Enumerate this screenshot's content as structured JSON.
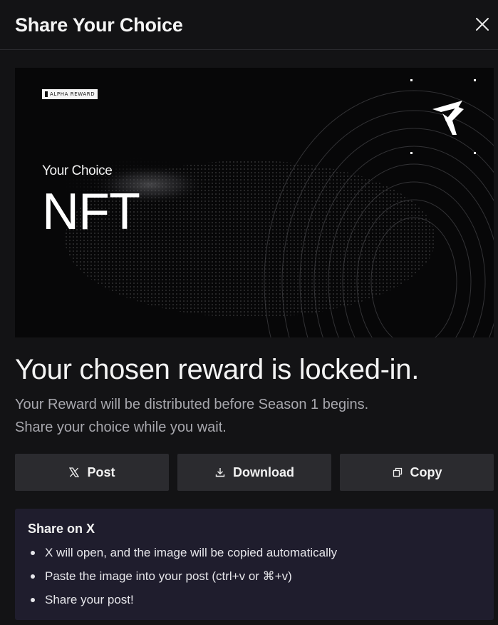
{
  "dialog": {
    "title": "Share Your Choice",
    "close_icon": "close-icon"
  },
  "banner": {
    "badge": "ALPHA REWARD",
    "subtitle": "Your Choice",
    "title": "NFT",
    "logo_icon": "brand-logo-icon"
  },
  "message": {
    "headline": "Your chosen reward is locked-in.",
    "line1": "Your Reward will be distributed before Season 1 begins.",
    "line2": "Share your choice while you wait."
  },
  "actions": {
    "post": {
      "label": "Post",
      "icon": "x-logo-icon"
    },
    "download": {
      "label": "Download",
      "icon": "download-icon"
    },
    "copy": {
      "label": "Copy",
      "icon": "copy-icon"
    }
  },
  "share_info": {
    "title": "Share on X",
    "items": [
      "X will open, and the image will be copied automatically",
      "Paste the image into your post (ctrl+v or ⌘+v)",
      "Share your post!"
    ]
  },
  "colors": {
    "background": "#131315",
    "button": "#2b2b2f",
    "info_box": "#1f1d2d",
    "muted_text": "#a7a7ad"
  }
}
